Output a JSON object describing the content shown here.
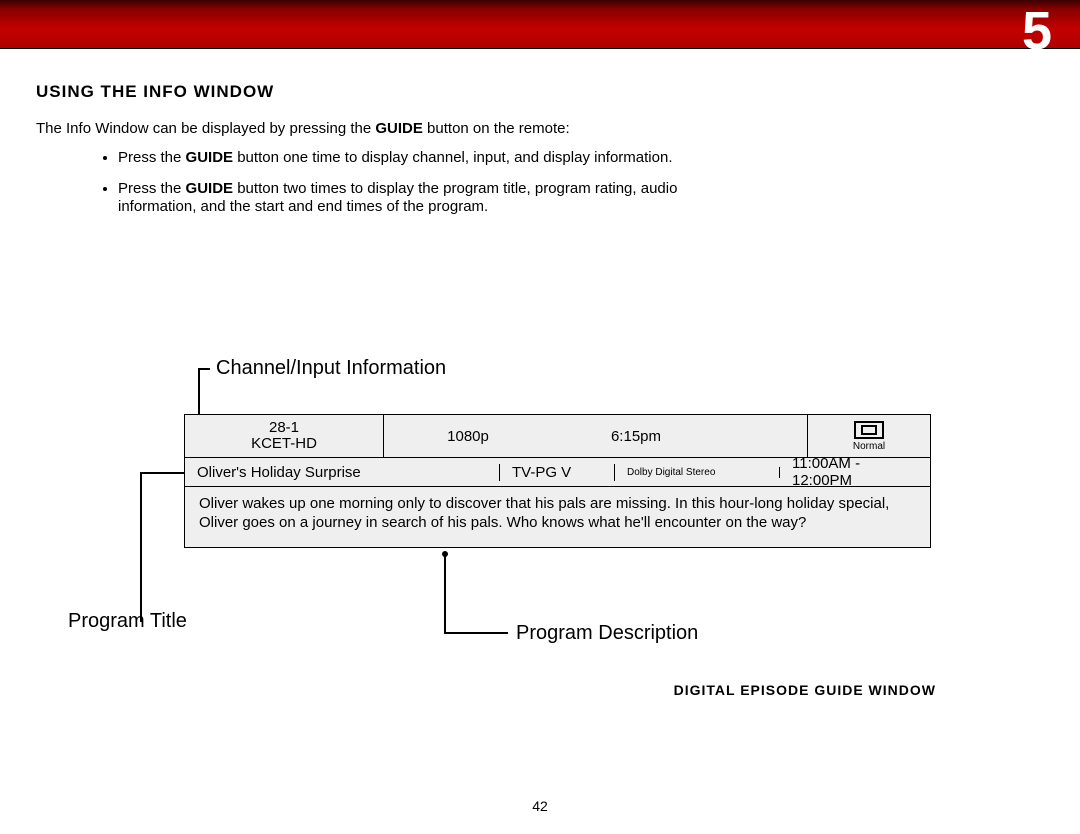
{
  "header": {
    "page_chapter": "5"
  },
  "section": {
    "title": "USING THE INFO WINDOW",
    "intro_pre": "The Info Window can be displayed by pressing the ",
    "intro_bold": "GUIDE",
    "intro_post": " button on the remote:",
    "bullet1_pre": "Press the ",
    "bullet1_bold": "GUIDE",
    "bullet1_post": " button one time to display channel, input, and display information.",
    "bullet2_pre": "Press the ",
    "bullet2_bold": "GUIDE",
    "bullet2_post": " button two times to display the program title, program rating, audio information, and the start and end times of the program."
  },
  "labels": {
    "channel": "Channel/Input Information",
    "prog_title": "Program Title",
    "prog_desc": "Program Description"
  },
  "info_window": {
    "channel_num": "28-1",
    "channel_name": "KCET-HD",
    "resolution": "1080p",
    "time": "6:15pm",
    "aspect_label": "Normal",
    "program_title": "Oliver's Holiday Surprise",
    "rating": "TV-PG V",
    "audio": "Dolby Digital Stereo",
    "timespan": "11:00AM - 12:00PM",
    "description": "Oliver wakes up one morning only to discover that his pals are missing. In this hour-long holiday special, Oliver goes on a journey in search of his pals. Who knows what he'll encounter on the way?"
  },
  "caption": "DIGITAL EPISODE GUIDE WINDOW",
  "page_number": "42"
}
